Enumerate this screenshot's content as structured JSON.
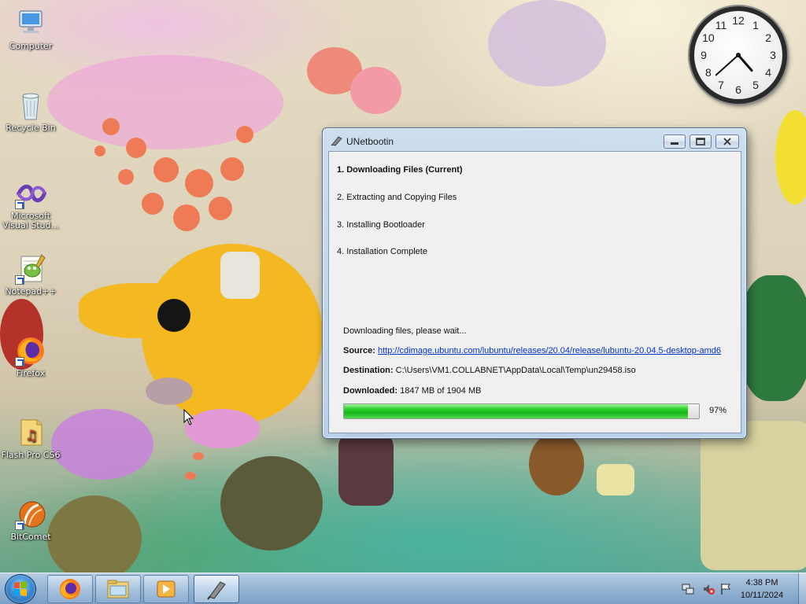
{
  "desktop": {
    "icons": [
      {
        "label": "Computer",
        "icon": "computer-icon"
      },
      {
        "label": "Recycle Bin",
        "icon": "recycle-bin-icon"
      },
      {
        "label": "Microsoft Visual Stud...",
        "icon": "visual-studio-icon"
      },
      {
        "label": "Notepad++",
        "icon": "notepad-plus-plus-icon"
      },
      {
        "label": "Firefox",
        "icon": "firefox-icon"
      },
      {
        "label": "Flash Pro CS6",
        "icon": "flash-pro-icon"
      },
      {
        "label": "BitComet",
        "icon": "bitcomet-icon"
      }
    ]
  },
  "clock": {
    "numbers": [
      "12",
      "1",
      "2",
      "3",
      "4",
      "5",
      "6",
      "7",
      "8",
      "9",
      "10",
      "11"
    ],
    "hour": 4,
    "minute": 38
  },
  "window": {
    "title": "UNetbootin",
    "steps": [
      "1. Downloading Files (Current)",
      "2. Extracting and Copying Files",
      "3. Installing Bootloader",
      "4. Installation Complete"
    ],
    "status": "Downloading files, please wait...",
    "source_label": "Source:",
    "source_url": "http://cdimage.ubuntu.com/lubuntu/releases/20.04/release/lubuntu-20.04.5-desktop-amd6",
    "destination_label": "Destination:",
    "destination_path": "C:\\Users\\VM1.COLLABNET\\AppData\\Local\\Temp\\un29458.iso",
    "downloaded_label": "Downloaded:",
    "downloaded_value": "1847 MB of 1904 MB",
    "progress_percent": 97,
    "progress_label": "97%"
  },
  "taskbar": {
    "pinned": [
      {
        "icon": "firefox-icon"
      },
      {
        "icon": "windows-explorer-icon"
      },
      {
        "icon": "media-player-icon"
      },
      {
        "icon": "unetbootin-icon",
        "active": true
      }
    ],
    "tray": {
      "time": "4:38 PM",
      "date": "10/11/2024"
    }
  },
  "colors": {
    "progress_green": "#16b416",
    "link_blue": "#0033cc",
    "window_frame": "#c2d6ee"
  }
}
